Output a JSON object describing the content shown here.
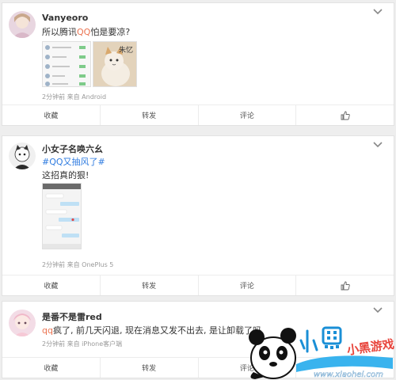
{
  "posts": [
    {
      "username": "Vanyeoro",
      "text_before": "所以腾讯",
      "text_highlight": "QQ",
      "text_after": "怕是要凉?",
      "meta": "2分钟前 来自 Android",
      "image_caption": "朱忆",
      "actions": {
        "favorite": "收藏",
        "repost": "转发",
        "comment": "评论"
      }
    },
    {
      "username": "小女子名唤六幺",
      "topic": "#QQ又抽风了#",
      "text": "这招真的狠!",
      "meta": "2分钟前 来自 OnePlus 5",
      "actions": {
        "favorite": "收藏",
        "repost": "转发",
        "comment": "评论"
      }
    },
    {
      "username": "是番不是雷red",
      "text_highlight": "qq",
      "text_after": "疯了, 前几天闪退, 现在消息又发不出去, 是让卸载了吗",
      "meta": "2分钟前 来自 iPhone客户端",
      "actions": {
        "favorite": "收藏",
        "repost": "转发",
        "comment": "评论"
      }
    }
  ],
  "watermark": {
    "brand": "小黑游戏",
    "url": "www.xiaohei.com"
  },
  "colors": {
    "highlight": "#eb7350",
    "link": "#2e7be0",
    "meta": "#999999"
  }
}
